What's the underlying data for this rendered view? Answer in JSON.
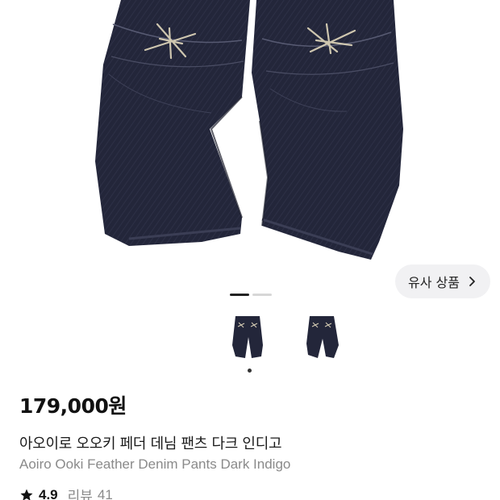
{
  "product": {
    "price": "179,000원",
    "title_ko": "아오이로 오오키 페더 데님 팬츠 다크 인디고",
    "title_en": "Aoiro Ooki Feather Denim Pants Dark Indigo",
    "rating": "4.9",
    "review_label": "리뷰",
    "review_count": "41"
  },
  "similar_button": {
    "label": "유사 상품",
    "icon": "chevron-right-icon"
  },
  "gallery": {
    "image": "denim-pants-back-view",
    "pages": 2,
    "active_page": 1,
    "thumbnails": [
      {
        "name": "thumbnail-1",
        "selected": true
      },
      {
        "name": "thumbnail-2",
        "selected": false
      }
    ]
  },
  "colors": {
    "denim": "#23263a",
    "denim_light": "#33364c",
    "embroidery": "#d8cfb6"
  }
}
